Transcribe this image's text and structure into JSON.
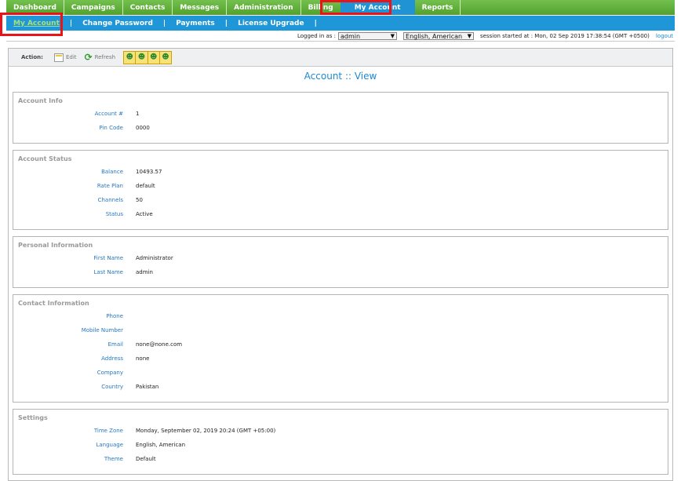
{
  "nav": {
    "items": [
      "Dashboard",
      "Campaigns",
      "Contacts",
      "Messages",
      "Administration",
      "Billing",
      "My Account",
      "Reports"
    ],
    "active": "My Account"
  },
  "subnav": {
    "items": [
      "My Account",
      "Change Password",
      "Payments",
      "License Upgrade"
    ],
    "separator": "|"
  },
  "status": {
    "logged_in_label": "Logged in as :",
    "user": "admin",
    "language": "English, American",
    "session": "session started at : Mon, 02 Sep 2019 17:38:54 (GMT +0500)",
    "logout": "logout"
  },
  "actions": {
    "label": "Action:",
    "edit": "Edit",
    "refresh": "Refresh"
  },
  "page_title": "Account :: View",
  "sections": {
    "account_info": {
      "title": "Account Info",
      "rows": [
        {
          "label": "Account #",
          "value": "1"
        },
        {
          "label": "Pin Code",
          "value": "0000"
        }
      ]
    },
    "account_status": {
      "title": "Account Status",
      "rows": [
        {
          "label": "Balance",
          "value": "10493.57"
        },
        {
          "label": "Rate Plan",
          "value": "default"
        },
        {
          "label": "Channels",
          "value": "50"
        },
        {
          "label": "Status",
          "value": "Active"
        }
      ]
    },
    "personal": {
      "title": "Personal Information",
      "rows": [
        {
          "label": "First Name",
          "value": "Administrator"
        },
        {
          "label": "Last Name",
          "value": "admin"
        }
      ]
    },
    "contact": {
      "title": "Contact Information",
      "rows": [
        {
          "label": "Phone",
          "value": ""
        },
        {
          "label": "Mobile Number",
          "value": ""
        },
        {
          "label": "Email",
          "value": "none@none.com"
        },
        {
          "label": "Address",
          "value": "none"
        },
        {
          "label": "Company",
          "value": ""
        },
        {
          "label": "Country",
          "value": "Pakistan"
        }
      ]
    },
    "settings": {
      "title": "Settings",
      "rows": [
        {
          "label": "Time Zone",
          "value": "Monday, September 02, 2019 20:24 (GMT +05:00)"
        },
        {
          "label": "Language",
          "value": "English, American"
        },
        {
          "label": "Theme",
          "value": "Default"
        }
      ]
    }
  },
  "colors": {
    "nav_green": "#5aa832",
    "sub_blue": "#1e96d8",
    "highlight_red": "#e8141a",
    "label_blue": "#2478c5"
  }
}
